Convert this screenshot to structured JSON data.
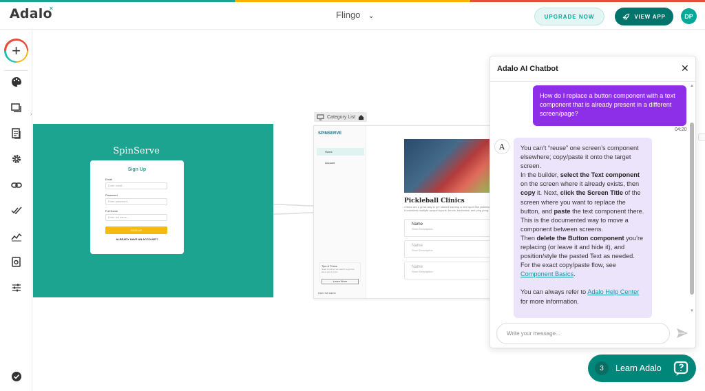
{
  "brand": {
    "name": "Adalo",
    "accent": "#00a898",
    "strip_colors": [
      "#1ca491",
      "#f4b400",
      "#e94c3c"
    ]
  },
  "header": {
    "app_name": "Flingo",
    "upgrade_label": "UPGRADE NOW",
    "view_app_label": "VIEW APP",
    "avatar_initials": "DP"
  },
  "sidebar": {
    "icons": [
      "add-icon",
      "palette-icon",
      "screens-icon",
      "database-icon",
      "gear-icon",
      "link-icon",
      "publish-check-icon",
      "analytics-icon",
      "marketplace-icon",
      "sliders-icon",
      "verified-icon"
    ]
  },
  "signup_screen": {
    "app_title": "SpinServe",
    "form_title": "Sign Up",
    "email_label": "Email",
    "email_placeholder": "Enter email...",
    "password_label": "Password",
    "password_placeholder": "Enter password...",
    "fullname_label": "Full Name",
    "fullname_placeholder": "Enter full name...",
    "signup_button": "SIGN UP",
    "already_link": "ALREADY HAVE AN ACCOUNT?"
  },
  "category_screen": {
    "label": "Category List",
    "logo": "SPINSERVE",
    "nav": [
      "Home",
      "Account"
    ],
    "tips_title": "Tips & Tricks",
    "tips_text": "Need to edit or set search to get the latest tips & tricks",
    "learn_more": "Learn More",
    "user_label": "User full name",
    "hero_title": "Pickleball Clinics",
    "hero_sub": "Clinics are a great way to get started learning a new sport like pickleball. It combines multiple racquet sports: tennis, badminton and ping pong.",
    "cards": [
      {
        "name": "Name",
        "desc": "Short Description"
      },
      {
        "name": "Name",
        "desc": "Short Description"
      },
      {
        "name": "Name",
        "desc": "Short Description"
      }
    ]
  },
  "chat": {
    "title": "Adalo AI Chatbot",
    "user_message": "How do I replace a button component with a text component that is already present in a different screen/page?",
    "user_time": "04:20",
    "bot_avatar": "A",
    "bot_p1": "You can’t “reuse” one screen’s component elsewhere; copy/paste it onto the target screen.",
    "bot_p2_a": "In the builder, ",
    "bot_p2_b": "select the Text component",
    "bot_p2_c": " on the screen where it already exists, then ",
    "bot_p2_d": "copy",
    "bot_p2_e": " it. Next, ",
    "bot_p2_f": "click the Screen Title",
    "bot_p2_g": " of the screen where you want to replace the button, and ",
    "bot_p2_h": "paste",
    "bot_p2_i": " the text component there. This is the documented way to move a component between screens.",
    "bot_p3_a": "Then ",
    "bot_p3_b": "delete the Button component",
    "bot_p3_c": " you’re replacing (or leave it and hide it), and position/style the pasted Text as needed. For the exact copy/paste flow, see ",
    "bot_p3_link": "Component Basics",
    "bot_p3_d": ".",
    "bot_p4_a": "You can always refer to ",
    "bot_p4_link": "Adalo Help Center",
    "bot_p4_b": " for more information.",
    "input_placeholder": "Write your message..."
  },
  "learn": {
    "count": "3",
    "label": "Learn Adalo"
  }
}
